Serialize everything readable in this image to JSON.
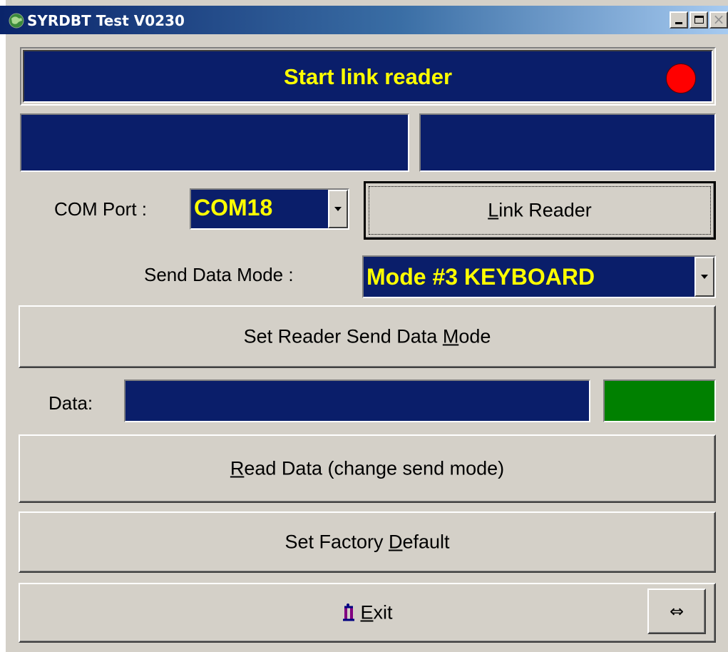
{
  "window": {
    "title": "SYRDBT Test  V0230",
    "icon": "app-globe-icon",
    "controls": [
      "minimize-icon",
      "maximize-icon",
      "close-icon"
    ]
  },
  "status": {
    "text": "Start link reader",
    "led_color": "#ff0000",
    "text_color": "#ffff00",
    "panel_color": "#0a1e6a"
  },
  "info_boxes": {
    "left_text": "",
    "right_text": ""
  },
  "com_port": {
    "label": "COM Port :",
    "value": "COM18"
  },
  "link_button": {
    "mnemonic": "L",
    "rest": "ink Reader"
  },
  "send_mode": {
    "label": "Send Data Mode :",
    "value": "Mode #3 KEYBOARD"
  },
  "set_mode_button": {
    "before": "Set Reader Send Data ",
    "mnemonic": "M",
    "after": "ode"
  },
  "data_row": {
    "label": "Data:",
    "value": "",
    "indicator_color": "#008000"
  },
  "read_button": {
    "mnemonic": "R",
    "rest": "ead Data (change send mode)"
  },
  "factory_button": {
    "before": "Set Factory ",
    "mnemonic": "D",
    "after": "efault"
  },
  "exit_button": {
    "icon": "exit-door-icon",
    "mnemonic": "E",
    "rest": "xit"
  },
  "swap_button": {
    "glyph": "⇔",
    "icon": "swap-arrows-icon"
  }
}
